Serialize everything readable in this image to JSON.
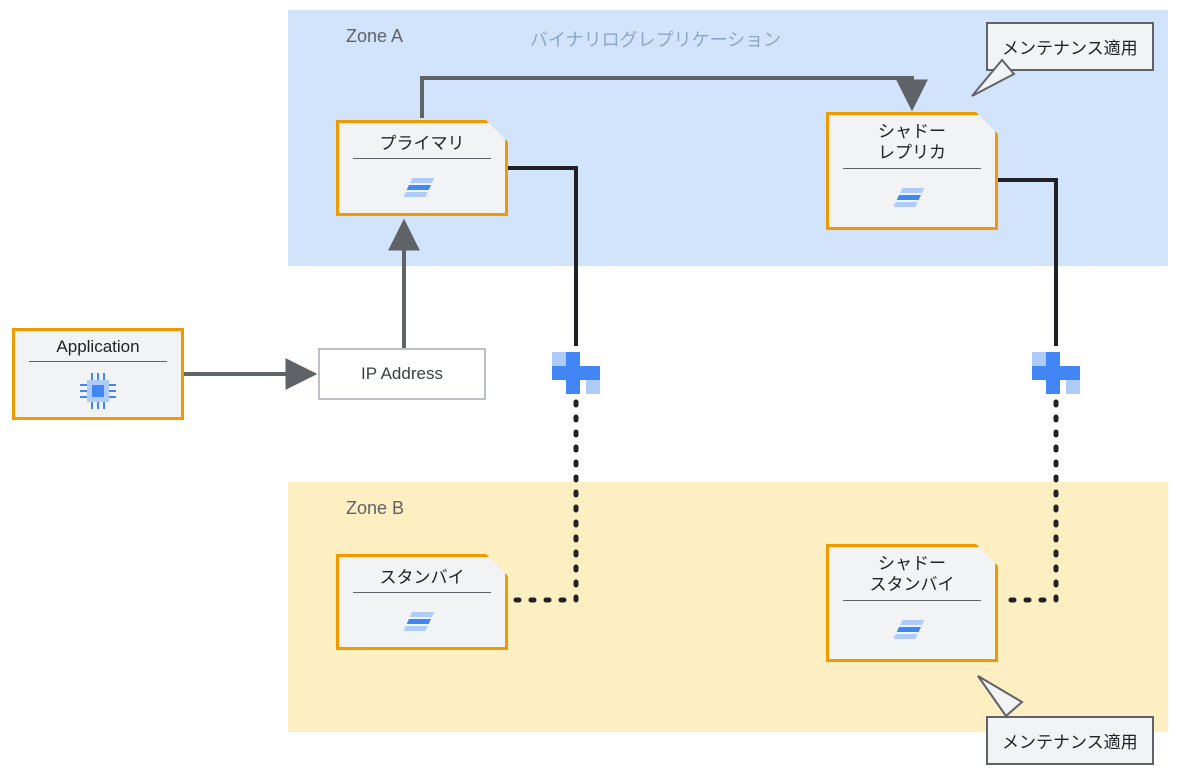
{
  "zones": {
    "a": {
      "label": "Zone A"
    },
    "b": {
      "label": "Zone B"
    }
  },
  "labels": {
    "replication": "バイナリログレプリケーション"
  },
  "nodes": {
    "application": {
      "title": "Application"
    },
    "ip": {
      "title": "IP Address"
    },
    "primary": {
      "title": "プライマリ"
    },
    "shadow_replica": {
      "title": "シャドー\nレプリカ"
    },
    "standby": {
      "title": "スタンバイ"
    },
    "shadow_standby": {
      "title": "シャドー\nスタンバイ"
    }
  },
  "callouts": {
    "maint_top": {
      "text": "メンテナンス適用"
    },
    "maint_bottom": {
      "text": "メンテナンス適用"
    }
  },
  "colors": {
    "accent": "#f29900",
    "zone_a": "#d2e3fc",
    "zone_b": "#feefc3",
    "arrow": "#5f6368",
    "blue_light": "#aecbfa",
    "blue_dark": "#4285f4"
  },
  "connections": [
    {
      "from": "application",
      "to": "ip",
      "style": "solid",
      "arrow": true
    },
    {
      "from": "ip",
      "to": "primary",
      "style": "solid",
      "arrow": true
    },
    {
      "from": "primary",
      "to": "shadow_replica",
      "style": "solid",
      "arrow": true,
      "label": "バイナリログレプリケーション"
    },
    {
      "from": "primary",
      "to": "standby",
      "style": "dotted",
      "arrow": false
    },
    {
      "from": "shadow_replica",
      "to": "shadow_standby",
      "style": "dotted",
      "arrow": false
    }
  ]
}
